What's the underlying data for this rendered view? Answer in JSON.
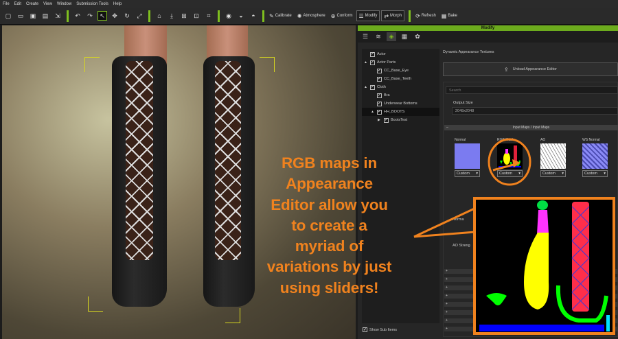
{
  "menubar": [
    "File",
    "Edit",
    "Create",
    "View",
    "Window",
    "Submission Tools",
    "Help"
  ],
  "toolbar": {
    "calibrate": "Calibrate",
    "atmosphere": "Atmosphere",
    "conform": "Conform",
    "modify": "Modify",
    "morph": "Morph",
    "refresh": "Refresh",
    "bake": "Bake"
  },
  "panel": {
    "title": "Modify",
    "section_title": "Dynamic Appearance Textures",
    "unload_button": "Unload Appearance Editor",
    "search_placeholder": "Search",
    "output_size_label": "Output Size",
    "output_size_value": "2048x2048",
    "input_maps_header": "Input Maps / Input Maps",
    "maps": [
      {
        "label": "Normal",
        "option": "Custom"
      },
      {
        "label": "RGB Mask",
        "option": "Custom"
      },
      {
        "label": "AO",
        "option": "Custom"
      },
      {
        "label": "WS Normal",
        "option": "Custom"
      }
    ],
    "normal_label": "Norma",
    "ao_strength_label": "AO Streng",
    "show_sub_items": "Show Sub Items"
  },
  "tree": [
    {
      "label": "Actor",
      "level": 0,
      "expander": ""
    },
    {
      "label": "Actor Parts",
      "level": 0,
      "expander": "▲"
    },
    {
      "label": "CC_Base_Eye",
      "level": 1,
      "expander": ""
    },
    {
      "label": "CC_Base_Teeth",
      "level": 1,
      "expander": ""
    },
    {
      "label": "Cloth",
      "level": 0,
      "expander": "▲"
    },
    {
      "label": "Bra",
      "level": 1,
      "expander": ""
    },
    {
      "label": "Underwear Bottoms",
      "level": 1,
      "expander": ""
    },
    {
      "label": "HH_BOOTS",
      "level": 1,
      "expander": "▲"
    },
    {
      "label": "BootsTest",
      "level": 2,
      "expander": "▶"
    }
  ],
  "callout": {
    "lines": [
      "RGB maps in",
      "Appearance",
      "Editor allow you",
      "to create a",
      "myriad of",
      "variations by just",
      "using sliders!"
    ],
    "color": "#f0821e"
  },
  "colors": {
    "accent": "#6cab1d",
    "highlight": "#f0821e"
  }
}
